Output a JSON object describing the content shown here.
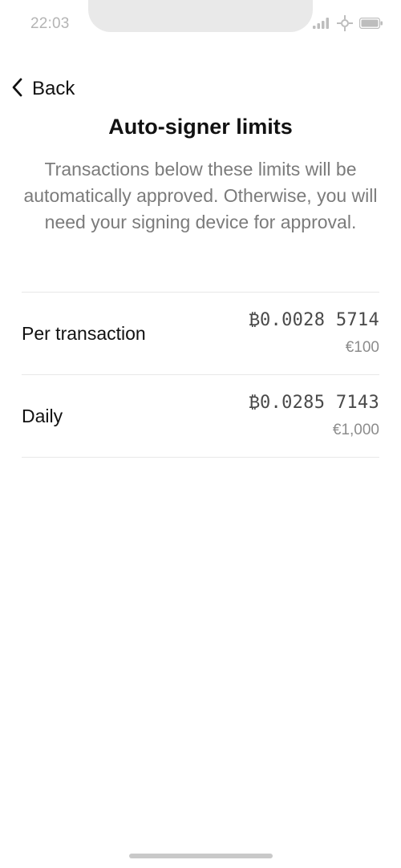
{
  "status_bar": {
    "time": "22:03",
    "icons": [
      "signal-icon",
      "sync-icon",
      "battery-icon"
    ]
  },
  "nav": {
    "back_label": "Back",
    "back_icon": "chevron-left-icon"
  },
  "page": {
    "title": "Auto-signer limits",
    "description": "Transactions below these limits will be automatically approved. Otherwise, you will need your signing device for approval."
  },
  "limits": [
    {
      "label": "Per transaction",
      "btc_amount": "₿0.0028 5714",
      "fiat_amount": "€100"
    },
    {
      "label": "Daily",
      "btc_amount": "₿0.0285 7143",
      "fiat_amount": "€1,000"
    }
  ],
  "colors": {
    "text_primary": "#111111",
    "text_secondary": "#7b7b7b",
    "status_gray": "#b4b4b4",
    "divider": "#e8e8e8"
  }
}
